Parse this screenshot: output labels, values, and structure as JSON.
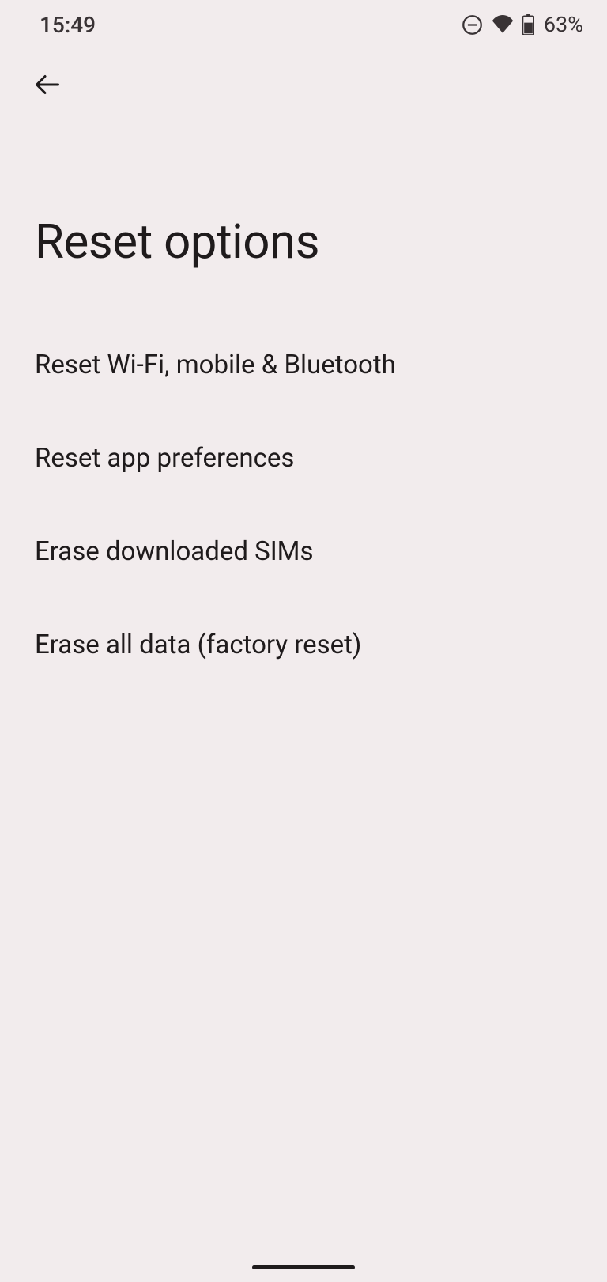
{
  "status_bar": {
    "time": "15:49",
    "battery_percent": "63%"
  },
  "page": {
    "title": "Reset options"
  },
  "options": [
    {
      "label": "Reset Wi-Fi, mobile & Bluetooth"
    },
    {
      "label": "Reset app preferences"
    },
    {
      "label": "Erase downloaded SIMs"
    },
    {
      "label": "Erase all data (factory reset)"
    }
  ]
}
